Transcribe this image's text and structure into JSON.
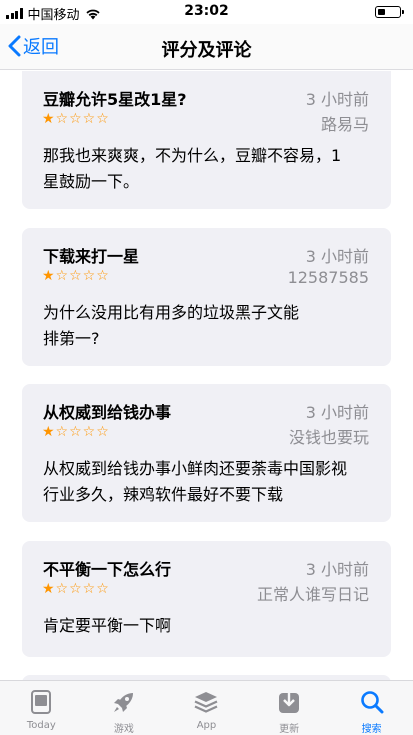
{
  "status_bar": {
    "carrier": "中国移动",
    "time": "23:02",
    "battery_level": 0.3
  },
  "nav": {
    "back_label": "返回",
    "title": "评分及评论"
  },
  "reviews": [
    {
      "title": "豆瓣允许5星改1星?",
      "time": "3 小时前",
      "author": "路易马",
      "rating": 1,
      "stars": "★☆☆☆☆",
      "body_lines": [
        "那我也来爽爽，不为什么，豆瓣不容易，1",
        "星鼓励一下。"
      ]
    },
    {
      "title": "下载来打一星",
      "time": "3 小时前",
      "author": "12587585",
      "rating": 1,
      "stars": "★☆☆☆☆",
      "body_lines": [
        "为什么没用比有用多的垃圾黑子文能",
        "排第一?"
      ]
    },
    {
      "title": "从权威到给钱办事",
      "time": "3 小时前",
      "author": "没钱也要玩",
      "rating": 1,
      "stars": "★☆☆☆☆",
      "body_lines": [
        "从权威到给钱办事小鲜肉还要荼毒中国影视",
        "行业多久，辣鸡软件最好不要下载"
      ]
    },
    {
      "title": "不平衡一下怎么行",
      "time": "3 小时前",
      "author": "正常人谁写日记",
      "rating": 1,
      "stars": "★☆☆☆☆",
      "body_lines": [
        "肯定要平衡一下啊"
      ]
    }
  ],
  "tabs": [
    {
      "label": "Today",
      "icon": "today-icon",
      "active": false
    },
    {
      "label": "游戏",
      "icon": "rocket-icon",
      "active": false
    },
    {
      "label": "App",
      "icon": "layers-icon",
      "active": false
    },
    {
      "label": "更新",
      "icon": "download-icon",
      "active": false
    },
    {
      "label": "搜索",
      "icon": "search-icon",
      "active": true
    }
  ],
  "colors": {
    "accent": "#0a7aff",
    "star": "#ff9500",
    "secondary_text": "#8e8e93",
    "card_bg": "#f0f0f5"
  }
}
